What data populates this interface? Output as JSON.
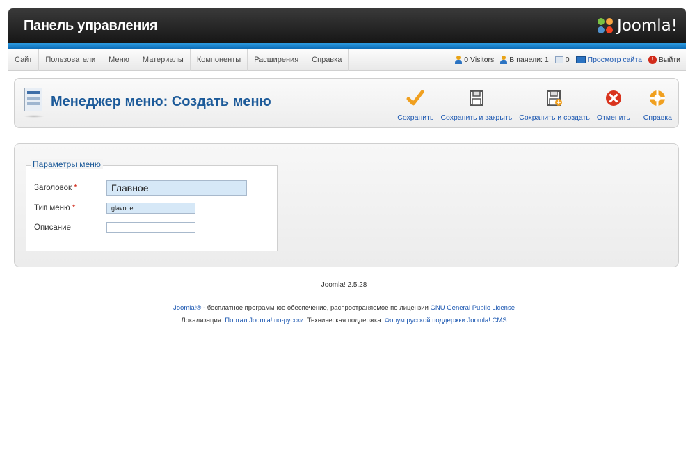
{
  "header": {
    "title": "Панель управления",
    "logo_text": "Joomla!"
  },
  "menu": {
    "items": [
      "Сайт",
      "Пользователи",
      "Меню",
      "Материалы",
      "Компоненты",
      "Расширения",
      "Справка"
    ]
  },
  "status": {
    "visitors": "0 Visitors",
    "admins": "В панели: 1",
    "messages": "0",
    "preview": "Просмотр сайта",
    "logout": "Выйти"
  },
  "toolbar": {
    "page_title": "Менеджер меню: Создать меню",
    "buttons": [
      {
        "label": "Сохранить",
        "icon": "check-icon"
      },
      {
        "label": "Сохранить и закрыть",
        "icon": "save-close-icon"
      },
      {
        "label": "Сохранить и создать",
        "icon": "save-new-icon"
      },
      {
        "label": "Отменить",
        "icon": "cancel-icon"
      },
      {
        "label": "Справка",
        "icon": "help-icon"
      }
    ]
  },
  "form": {
    "legend": "Параметры меню",
    "fields": [
      {
        "label": "Заголовок",
        "required": true,
        "value": "Главное"
      },
      {
        "label": "Тип меню",
        "required": true,
        "value": "glavnoe"
      },
      {
        "label": "Описание",
        "required": false,
        "value": ""
      }
    ]
  },
  "footer": {
    "version": "Joomla! 2.5.28",
    "line1_link1": "Joomla!®",
    "line1_text": " - бесплатное программное обеспечение, распространяемое по лицензии ",
    "line1_link2": "GNU General Public License",
    "line2_text1": "Локализация: ",
    "line2_link1": "Портал Joomla! по-русски",
    "line2_text2": ". Техническая поддержка: ",
    "line2_link2": "Форум русской поддержки Joomla! CMS"
  },
  "colors": {
    "accent_blue": "#1c5a99",
    "link_blue": "#1b57b1",
    "header_dark": "#1e1e1e",
    "stripe_blue": "#1a82cf",
    "required_red": "#d12a1a",
    "input_bg": "#d6e8f7"
  }
}
